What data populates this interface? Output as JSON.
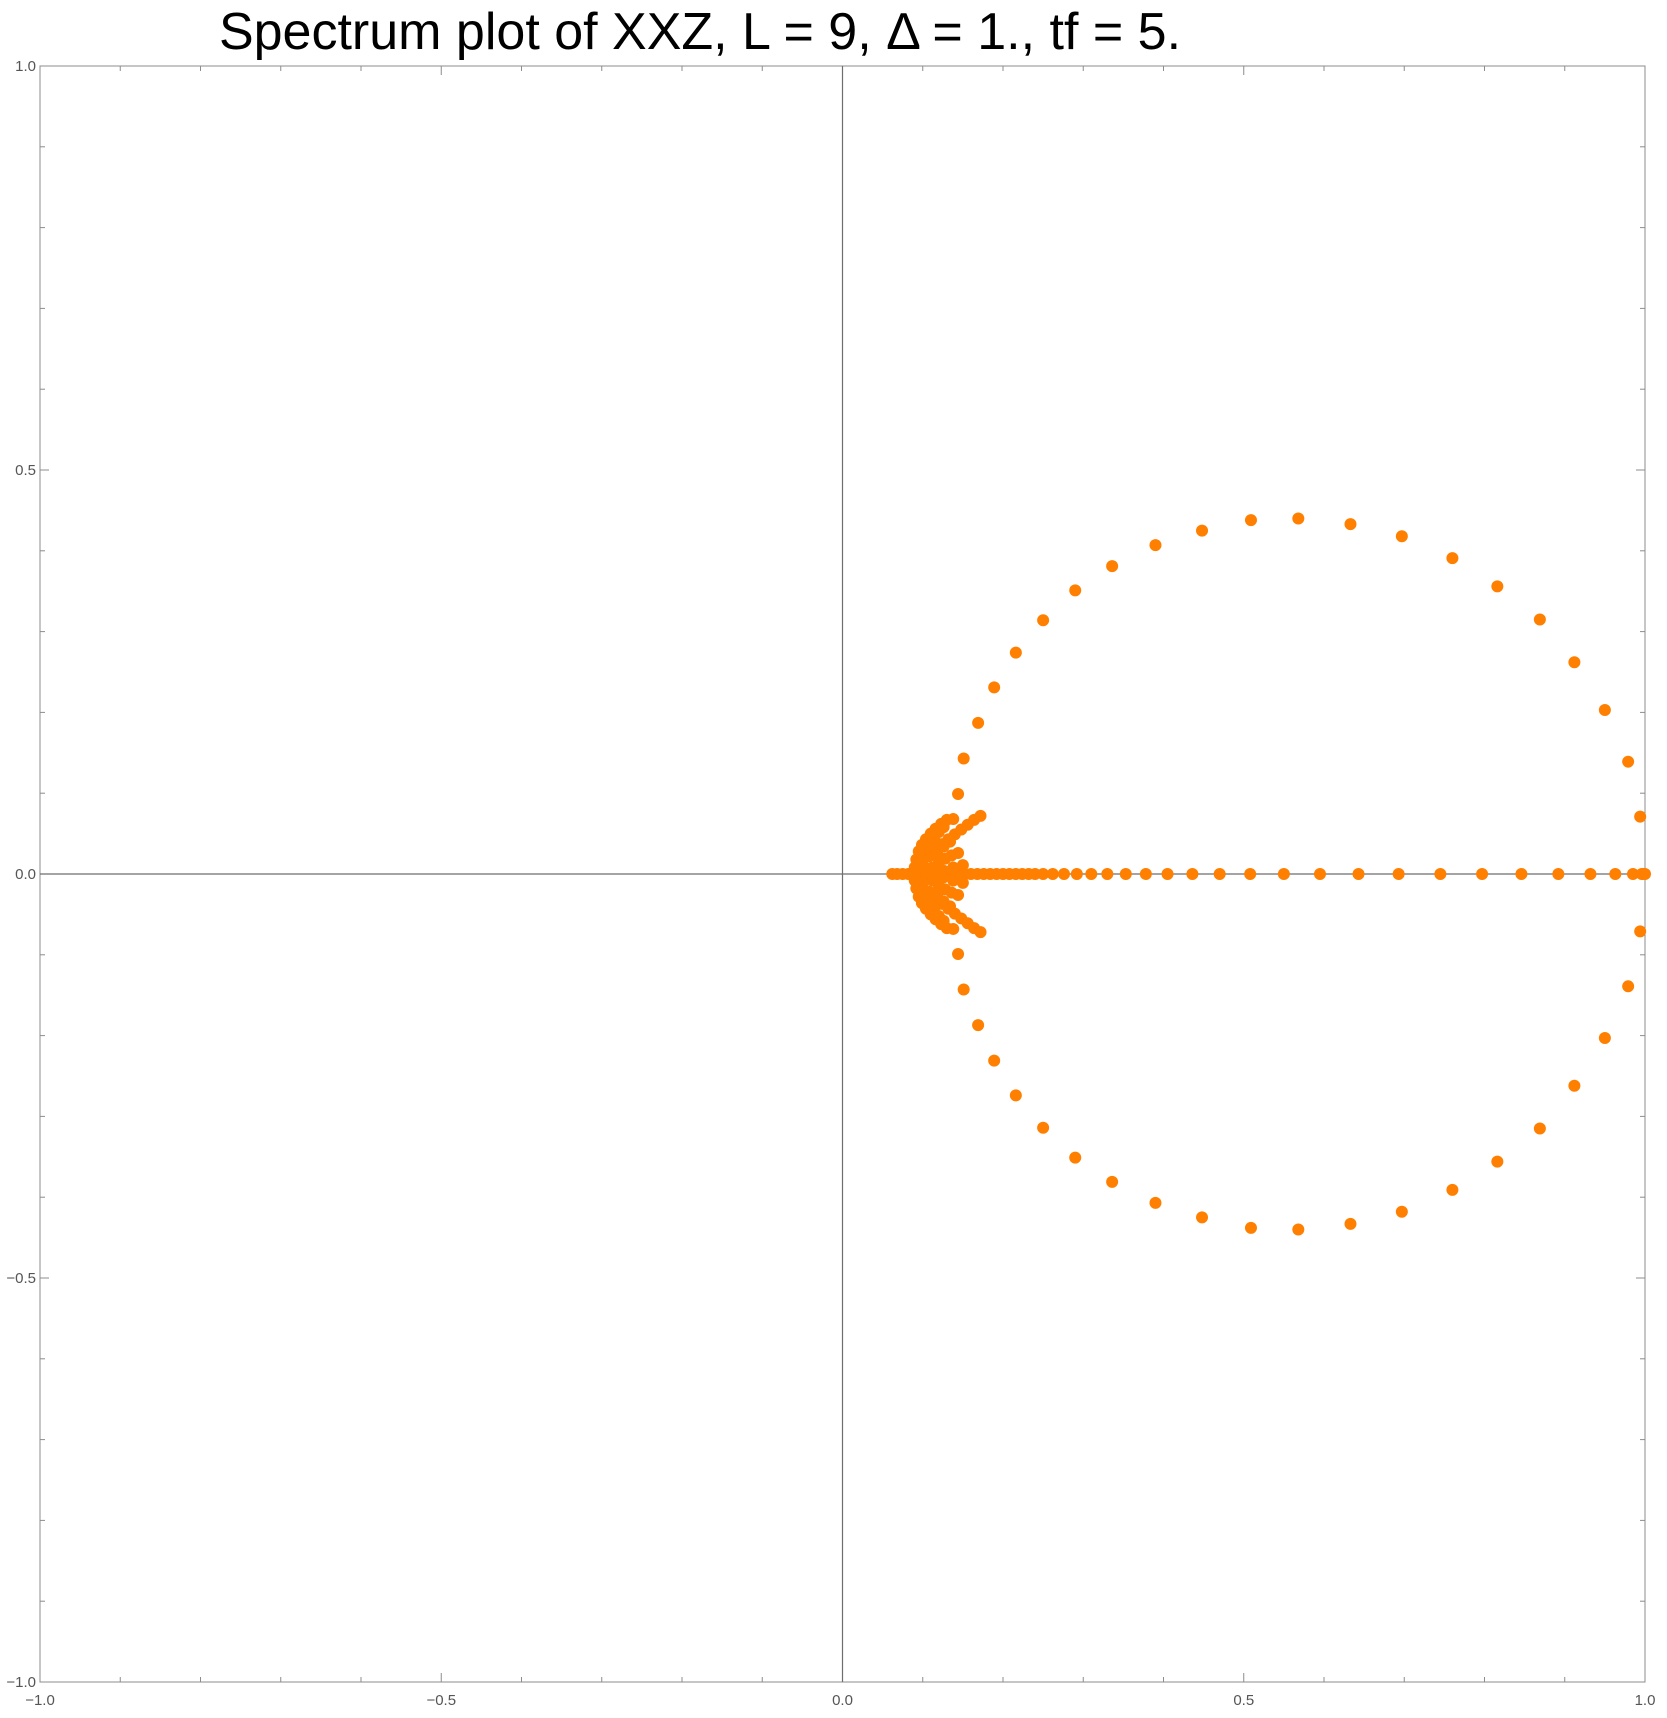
{
  "chart_data": {
    "type": "scatter",
    "title": "Spectrum plot of XXZ, L = 9, Δ = 1., tf = 5.",
    "xlabel": "",
    "ylabel": "",
    "xlim": [
      -1.0,
      1.0
    ],
    "ylim": [
      -1.0,
      1.0
    ],
    "x_ticks": [
      -1.0,
      -0.5,
      0.0,
      0.5,
      1.0
    ],
    "x_tick_labels": [
      "−1.0",
      "−0.5",
      "0.0",
      "0.5",
      "1.0"
    ],
    "y_ticks": [
      -1.0,
      -0.5,
      0.0,
      0.5,
      1.0
    ],
    "y_tick_labels": [
      "−1.0",
      "−0.5",
      "0.0",
      "0.5",
      "1.0"
    ],
    "grid": false,
    "axes_origin": [
      0,
      0
    ],
    "marker_color": "#ff7f00",
    "series": [
      {
        "points": [
          [
            0.568,
            0.44
          ],
          [
            0.633,
            0.433
          ],
          [
            0.697,
            0.418
          ],
          [
            0.76,
            0.391
          ],
          [
            0.816,
            0.356
          ],
          [
            0.869,
            0.315
          ],
          [
            0.912,
            0.262
          ],
          [
            0.95,
            0.203
          ],
          [
            0.979,
            0.139
          ],
          [
            0.994,
            0.071
          ],
          [
            0.998,
            0.0
          ],
          [
            0.994,
            -0.071
          ],
          [
            0.979,
            -0.139
          ],
          [
            0.95,
            -0.203
          ],
          [
            0.912,
            -0.262
          ],
          [
            0.869,
            -0.315
          ],
          [
            0.816,
            -0.356
          ],
          [
            0.76,
            -0.391
          ],
          [
            0.697,
            -0.418
          ],
          [
            0.633,
            -0.433
          ],
          [
            0.568,
            -0.44
          ],
          [
            0.509,
            -0.438
          ],
          [
            0.448,
            -0.425
          ],
          [
            0.39,
            -0.407
          ],
          [
            0.336,
            -0.381
          ],
          [
            0.29,
            -0.351
          ],
          [
            0.25,
            -0.314
          ],
          [
            0.216,
            -0.274
          ],
          [
            0.189,
            -0.231
          ],
          [
            0.169,
            -0.187
          ],
          [
            0.151,
            -0.143
          ],
          [
            0.144,
            -0.099
          ],
          [
            0.509,
            0.438
          ],
          [
            0.448,
            0.425
          ],
          [
            0.39,
            0.407
          ],
          [
            0.336,
            0.381
          ],
          [
            0.29,
            0.351
          ],
          [
            0.25,
            0.314
          ],
          [
            0.216,
            0.274
          ],
          [
            0.189,
            0.231
          ],
          [
            0.169,
            0.187
          ],
          [
            0.151,
            0.143
          ],
          [
            0.144,
            0.099
          ],
          [
            0.062,
            0.0
          ],
          [
            0.068,
            0.0
          ],
          [
            0.075,
            0.0
          ],
          [
            0.082,
            0.0
          ],
          [
            0.089,
            0.0
          ],
          [
            0.096,
            0.0
          ],
          [
            0.104,
            0.0
          ],
          [
            0.112,
            0.0
          ],
          [
            0.12,
            0.0
          ],
          [
            0.128,
            0.0
          ],
          [
            0.136,
            0.0
          ],
          [
            0.144,
            0.0
          ],
          [
            0.152,
            0.0
          ],
          [
            0.16,
            0.0
          ],
          [
            0.168,
            0.0
          ],
          [
            0.176,
            0.0
          ],
          [
            0.184,
            0.0
          ],
          [
            0.192,
            0.0
          ],
          [
            0.2,
            0.0
          ],
          [
            0.208,
            0.0
          ],
          [
            0.216,
            0.0
          ],
          [
            0.224,
            0.0
          ],
          [
            0.232,
            0.0
          ],
          [
            0.24,
            0.0
          ],
          [
            0.25,
            0.0
          ],
          [
            0.262,
            0.0
          ],
          [
            0.276,
            0.0
          ],
          [
            0.292,
            0.0
          ],
          [
            0.31,
            0.0
          ],
          [
            0.33,
            0.0
          ],
          [
            0.353,
            0.0
          ],
          [
            0.378,
            0.0
          ],
          [
            0.405,
            0.0
          ],
          [
            0.436,
            0.0
          ],
          [
            0.47,
            0.0
          ],
          [
            0.508,
            0.0
          ],
          [
            0.55,
            0.0
          ],
          [
            0.595,
            0.0
          ],
          [
            0.643,
            0.0
          ],
          [
            0.693,
            0.0
          ],
          [
            0.745,
            0.0
          ],
          [
            0.797,
            0.0
          ],
          [
            0.846,
            0.0
          ],
          [
            0.892,
            0.0
          ],
          [
            0.932,
            0.0
          ],
          [
            0.963,
            0.0
          ],
          [
            0.985,
            0.0
          ],
          [
            0.996,
            0.0
          ],
          [
            1.0,
            0.0
          ],
          [
            0.09,
            0.008
          ],
          [
            0.092,
            0.018
          ],
          [
            0.095,
            0.028
          ],
          [
            0.099,
            0.036
          ],
          [
            0.104,
            0.043
          ],
          [
            0.11,
            0.05
          ],
          [
            0.116,
            0.056
          ],
          [
            0.123,
            0.062
          ],
          [
            0.13,
            0.067
          ],
          [
            0.138,
            0.068
          ],
          [
            0.09,
            -0.008
          ],
          [
            0.092,
            -0.018
          ],
          [
            0.095,
            -0.028
          ],
          [
            0.099,
            -0.036
          ],
          [
            0.104,
            -0.043
          ],
          [
            0.11,
            -0.05
          ],
          [
            0.116,
            -0.056
          ],
          [
            0.123,
            -0.062
          ],
          [
            0.13,
            -0.067
          ],
          [
            0.138,
            -0.068
          ],
          [
            0.1,
            0.012
          ],
          [
            0.108,
            0.022
          ],
          [
            0.116,
            0.03
          ],
          [
            0.124,
            0.037
          ],
          [
            0.132,
            0.043
          ],
          [
            0.14,
            0.049
          ],
          [
            0.148,
            0.055
          ],
          [
            0.156,
            0.061
          ],
          [
            0.164,
            0.067
          ],
          [
            0.172,
            0.072
          ],
          [
            0.1,
            -0.012
          ],
          [
            0.108,
            -0.022
          ],
          [
            0.116,
            -0.03
          ],
          [
            0.124,
            -0.037
          ],
          [
            0.132,
            -0.043
          ],
          [
            0.14,
            -0.049
          ],
          [
            0.148,
            -0.055
          ],
          [
            0.156,
            -0.061
          ],
          [
            0.164,
            -0.067
          ],
          [
            0.172,
            -0.072
          ],
          [
            0.112,
            0.008
          ],
          [
            0.12,
            0.014
          ],
          [
            0.128,
            0.019
          ],
          [
            0.136,
            0.023
          ],
          [
            0.144,
            0.026
          ],
          [
            0.112,
            -0.008
          ],
          [
            0.12,
            -0.014
          ],
          [
            0.128,
            -0.019
          ],
          [
            0.136,
            -0.023
          ],
          [
            0.144,
            -0.026
          ],
          [
            0.126,
            0.004
          ],
          [
            0.138,
            0.008
          ],
          [
            0.15,
            0.011
          ],
          [
            0.126,
            -0.004
          ],
          [
            0.138,
            -0.008
          ],
          [
            0.15,
            -0.011
          ],
          [
            0.108,
            0.035
          ],
          [
            0.114,
            0.044
          ],
          [
            0.12,
            0.052
          ],
          [
            0.126,
            0.058
          ],
          [
            0.108,
            -0.035
          ],
          [
            0.114,
            -0.044
          ],
          [
            0.12,
            -0.052
          ],
          [
            0.126,
            -0.058
          ],
          [
            0.118,
            0.026
          ],
          [
            0.126,
            0.034
          ],
          [
            0.134,
            0.04
          ],
          [
            0.118,
            -0.026
          ],
          [
            0.126,
            -0.034
          ],
          [
            0.134,
            -0.04
          ],
          [
            0.096,
            0.022
          ],
          [
            0.102,
            0.03
          ],
          [
            0.096,
            -0.022
          ],
          [
            0.102,
            -0.03
          ]
        ]
      }
    ]
  }
}
